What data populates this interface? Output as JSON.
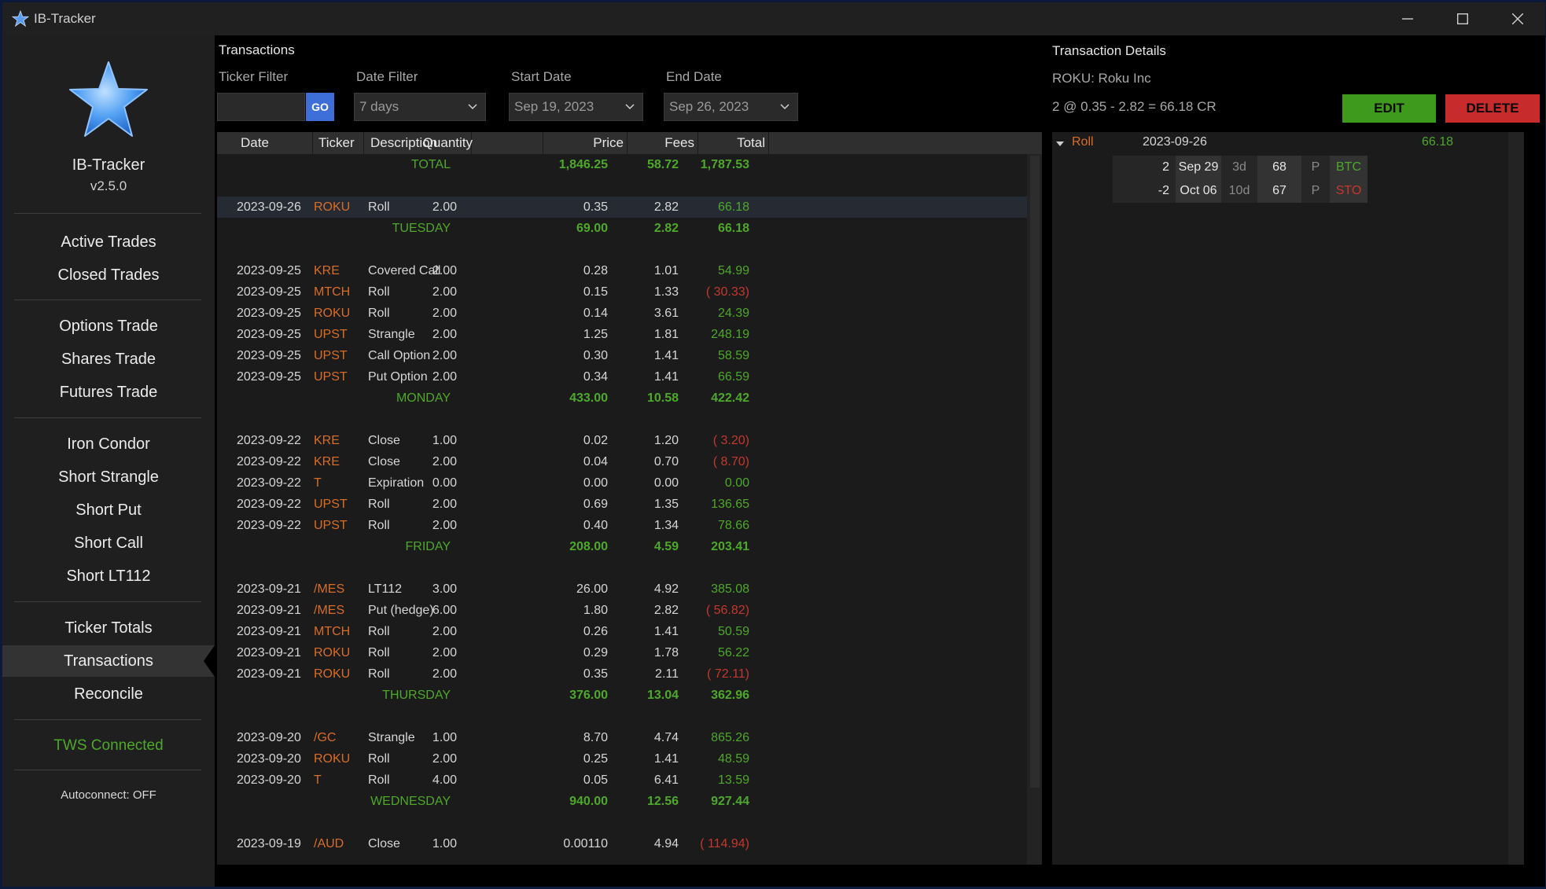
{
  "window": {
    "title": "IB-Tracker"
  },
  "sidebar": {
    "app_name": "IB-Tracker",
    "version": "v2.5.0",
    "groups": [
      [
        "Active Trades",
        "Closed Trades"
      ],
      [
        "Options Trade",
        "Shares Trade",
        "Futures Trade"
      ],
      [
        "Iron Condor",
        "Short Strangle",
        "Short Put",
        "Short Call",
        "Short LT112"
      ],
      [
        "Ticker Totals",
        "Transactions",
        "Reconcile"
      ]
    ],
    "selected": "Transactions",
    "status": "TWS Connected",
    "autoconnect": "Autoconnect: OFF"
  },
  "transactions": {
    "title": "Transactions",
    "filters": {
      "ticker_label": "Ticker Filter",
      "ticker_value": "",
      "go_label": "GO",
      "date_label": "Date Filter",
      "date_value": "7 days",
      "start_label": "Start Date",
      "start_value": "Sep 19, 2023",
      "end_label": "End Date",
      "end_value": "Sep 26, 2023"
    },
    "columns": [
      "Date",
      "Ticker",
      "Description",
      "Quantity",
      "Price",
      "Fees",
      "Total"
    ],
    "rows": [
      {
        "kind": "total",
        "label": "TOTAL",
        "price": "1,846.25",
        "fees": "58.72",
        "total": "1,787.53"
      },
      {
        "kind": "blank"
      },
      {
        "kind": "tx",
        "date": "2023-09-26",
        "ticker": "ROKU",
        "desc": "Roll",
        "qty": "2.00",
        "price": "0.35",
        "fees": "2.82",
        "total": "66.18",
        "neg": false,
        "hl": true
      },
      {
        "kind": "sum",
        "label": "TUESDAY",
        "price": "69.00",
        "fees": "2.82",
        "total": "66.18"
      },
      {
        "kind": "blank"
      },
      {
        "kind": "tx",
        "date": "2023-09-25",
        "ticker": "KRE",
        "desc": "Covered Call",
        "qty": "2.00",
        "price": "0.28",
        "fees": "1.01",
        "total": "54.99",
        "neg": false
      },
      {
        "kind": "tx",
        "date": "2023-09-25",
        "ticker": "MTCH",
        "desc": "Roll",
        "qty": "2.00",
        "price": "0.15",
        "fees": "1.33",
        "total": "( 30.33)",
        "neg": true
      },
      {
        "kind": "tx",
        "date": "2023-09-25",
        "ticker": "ROKU",
        "desc": "Roll",
        "qty": "2.00",
        "price": "0.14",
        "fees": "3.61",
        "total": "24.39",
        "neg": false
      },
      {
        "kind": "tx",
        "date": "2023-09-25",
        "ticker": "UPST",
        "desc": "Strangle",
        "qty": "2.00",
        "price": "1.25",
        "fees": "1.81",
        "total": "248.19",
        "neg": false
      },
      {
        "kind": "tx",
        "date": "2023-09-25",
        "ticker": "UPST",
        "desc": "Call Option",
        "qty": "2.00",
        "price": "0.30",
        "fees": "1.41",
        "total": "58.59",
        "neg": false
      },
      {
        "kind": "tx",
        "date": "2023-09-25",
        "ticker": "UPST",
        "desc": "Put Option",
        "qty": "2.00",
        "price": "0.34",
        "fees": "1.41",
        "total": "66.59",
        "neg": false
      },
      {
        "kind": "sum",
        "label": "MONDAY",
        "price": "433.00",
        "fees": "10.58",
        "total": "422.42"
      },
      {
        "kind": "blank"
      },
      {
        "kind": "tx",
        "date": "2023-09-22",
        "ticker": "KRE",
        "desc": "Close",
        "qty": "1.00",
        "price": "0.02",
        "fees": "1.20",
        "total": "( 3.20)",
        "neg": true
      },
      {
        "kind": "tx",
        "date": "2023-09-22",
        "ticker": "KRE",
        "desc": "Close",
        "qty": "2.00",
        "price": "0.04",
        "fees": "0.70",
        "total": "( 8.70)",
        "neg": true
      },
      {
        "kind": "tx",
        "date": "2023-09-22",
        "ticker": "T",
        "desc": "Expiration",
        "qty": "0.00",
        "price": "0.00",
        "fees": "0.00",
        "total": "0.00",
        "neg": false
      },
      {
        "kind": "tx",
        "date": "2023-09-22",
        "ticker": "UPST",
        "desc": "Roll",
        "qty": "2.00",
        "price": "0.69",
        "fees": "1.35",
        "total": "136.65",
        "neg": false
      },
      {
        "kind": "tx",
        "date": "2023-09-22",
        "ticker": "UPST",
        "desc": "Roll",
        "qty": "2.00",
        "price": "0.40",
        "fees": "1.34",
        "total": "78.66",
        "neg": false
      },
      {
        "kind": "sum",
        "label": "FRIDAY",
        "price": "208.00",
        "fees": "4.59",
        "total": "203.41"
      },
      {
        "kind": "blank"
      },
      {
        "kind": "tx",
        "date": "2023-09-21",
        "ticker": "/MES",
        "desc": "LT112",
        "qty": "3.00",
        "price": "26.00",
        "fees": "4.92",
        "total": "385.08",
        "neg": false
      },
      {
        "kind": "tx",
        "date": "2023-09-21",
        "ticker": "/MES",
        "desc": "Put (hedge)",
        "qty": "6.00",
        "price": "1.80",
        "fees": "2.82",
        "total": "( 56.82)",
        "neg": true
      },
      {
        "kind": "tx",
        "date": "2023-09-21",
        "ticker": "MTCH",
        "desc": "Roll",
        "qty": "2.00",
        "price": "0.26",
        "fees": "1.41",
        "total": "50.59",
        "neg": false
      },
      {
        "kind": "tx",
        "date": "2023-09-21",
        "ticker": "ROKU",
        "desc": "Roll",
        "qty": "2.00",
        "price": "0.29",
        "fees": "1.78",
        "total": "56.22",
        "neg": false
      },
      {
        "kind": "tx",
        "date": "2023-09-21",
        "ticker": "ROKU",
        "desc": "Roll",
        "qty": "2.00",
        "price": "0.35",
        "fees": "2.11",
        "total": "( 72.11)",
        "neg": true
      },
      {
        "kind": "sum",
        "label": "THURSDAY",
        "price": "376.00",
        "fees": "13.04",
        "total": "362.96"
      },
      {
        "kind": "blank"
      },
      {
        "kind": "tx",
        "date": "2023-09-20",
        "ticker": "/GC",
        "desc": "Strangle",
        "qty": "1.00",
        "price": "8.70",
        "fees": "4.74",
        "total": "865.26",
        "neg": false
      },
      {
        "kind": "tx",
        "date": "2023-09-20",
        "ticker": "ROKU",
        "desc": "Roll",
        "qty": "2.00",
        "price": "0.25",
        "fees": "1.41",
        "total": "48.59",
        "neg": false
      },
      {
        "kind": "tx",
        "date": "2023-09-20",
        "ticker": "T",
        "desc": "Roll",
        "qty": "4.00",
        "price": "0.05",
        "fees": "6.41",
        "total": "13.59",
        "neg": false
      },
      {
        "kind": "sum",
        "label": "WEDNESDAY",
        "price": "940.00",
        "fees": "12.56",
        "total": "927.44"
      },
      {
        "kind": "blank"
      },
      {
        "kind": "tx",
        "date": "2023-09-19",
        "ticker": "/AUD",
        "desc": "Close",
        "qty": "1.00",
        "price": "0.00110",
        "fees": "4.94",
        "total": "( 114.94)",
        "neg": true
      }
    ]
  },
  "details": {
    "title": "Transaction Details",
    "instrument": "ROKU: Roku Inc",
    "summary": "2 @ 0.35 - 2.82 = 66.18 CR",
    "edit_label": "EDIT",
    "delete_label": "DELETE",
    "group": {
      "label": "Roll",
      "date": "2023-09-26",
      "total": "66.18"
    },
    "legs": [
      {
        "qty": "2",
        "expiry": "Sep 29",
        "dte": "3d",
        "strike": "68",
        "type": "P",
        "action": "BTC"
      },
      {
        "qty": "-2",
        "expiry": "Oct 06",
        "dte": "10d",
        "strike": "67",
        "type": "P",
        "action": "STO"
      }
    ],
    "colors": {
      "edit": "#3e9a1d",
      "delete": "#c72b2b",
      "btc": "#4ea82b",
      "sto": "#c4382e"
    }
  }
}
